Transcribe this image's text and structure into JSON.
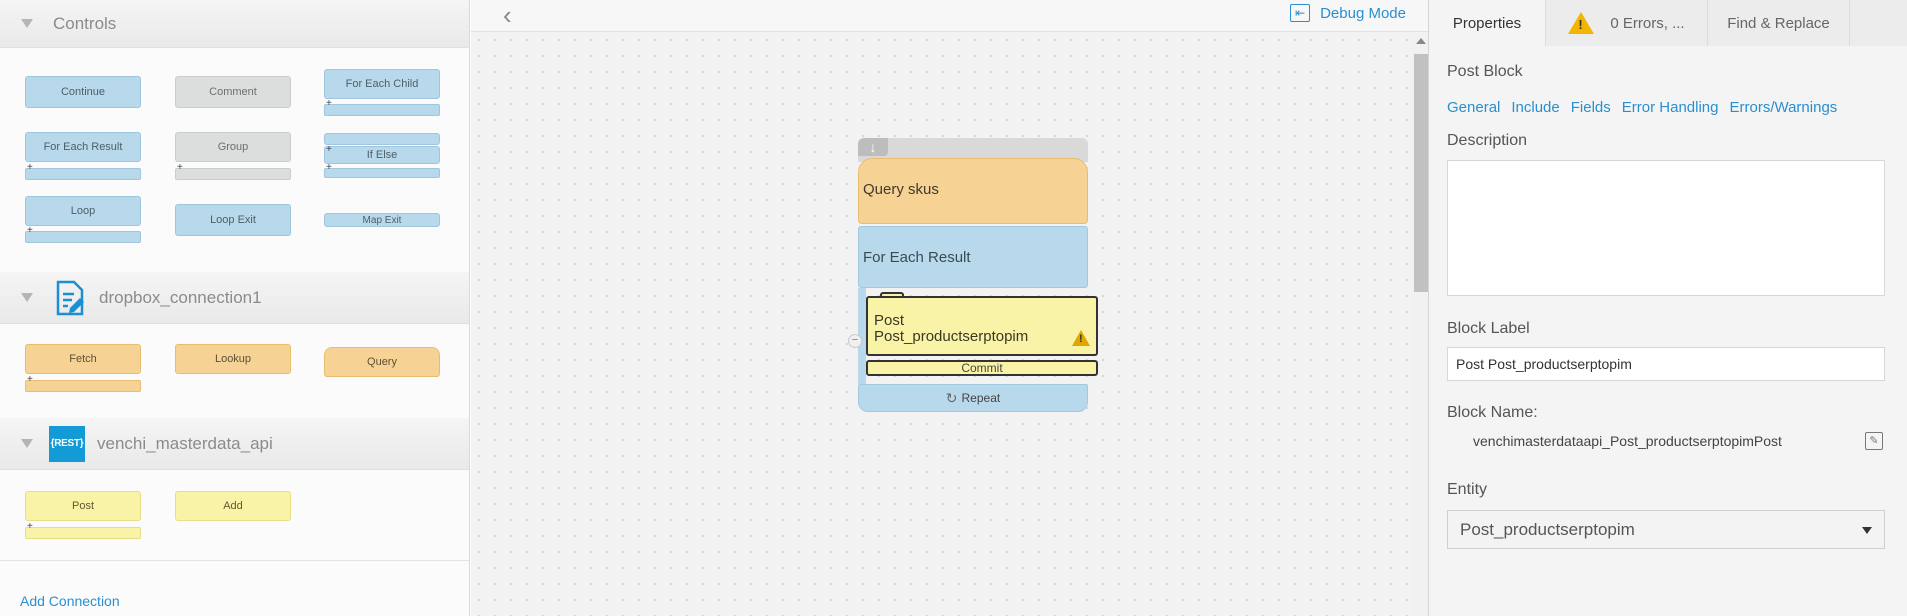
{
  "palette": {
    "controls_title": "Controls",
    "controls": [
      {
        "label": "Continue"
      },
      {
        "label": "Comment"
      },
      {
        "label": "For Each Child"
      },
      {
        "label": "For Each Result"
      },
      {
        "label": "Group"
      },
      {
        "label": "If Else"
      },
      {
        "label": "Loop"
      },
      {
        "label": "Loop Exit"
      },
      {
        "label": "Map Exit"
      }
    ],
    "connection1": {
      "title": "dropbox_connection1",
      "blocks": [
        {
          "label": "Fetch"
        },
        {
          "label": "Lookup"
        },
        {
          "label": "Query"
        }
      ]
    },
    "connection2": {
      "icon_text": "{REST}",
      "title": "venchi_masterdata_api",
      "blocks": [
        {
          "label": "Post"
        },
        {
          "label": "Add"
        }
      ]
    },
    "add_connection": "Add Connection"
  },
  "canvas": {
    "debug_mode": "Debug Mode",
    "flow": {
      "query": "Query skus",
      "for_each": "For Each Result",
      "post_line1": "Post",
      "post_line2": "Post_productserptopim",
      "commit": "Commit",
      "repeat": "Repeat"
    }
  },
  "properties": {
    "tabs": {
      "properties": "Properties",
      "errors": "0 Errors, ...",
      "find_replace": "Find & Replace"
    },
    "block_type": "Post Block",
    "links": [
      "General",
      "Include",
      "Fields",
      "Error Handling",
      "Errors/Warnings"
    ],
    "description_label": "Description",
    "description_value": "",
    "block_label_label": "Block Label",
    "block_label_value": "Post Post_productserptopim",
    "block_name_label": "Block Name:",
    "block_name_value": "venchimasterdataapi_Post_productserptopimPost",
    "entity_label": "Entity",
    "entity_value": "Post_productserptopim"
  },
  "colors": {
    "link": "#2a8fcf",
    "control_block": "#b8d9ec",
    "query_block": "#f6d395",
    "post_block": "#f8f3a6",
    "warning": "#f2b500"
  },
  "icons": [
    "collapse-caret-icon",
    "dropbox-connection-icon",
    "rest-api-icon",
    "back-chevron-icon",
    "debug-mode-icon",
    "warning-icon",
    "edit-icon",
    "dropdown-caret-icon",
    "repeat-icon",
    "down-arrow-icon"
  ]
}
